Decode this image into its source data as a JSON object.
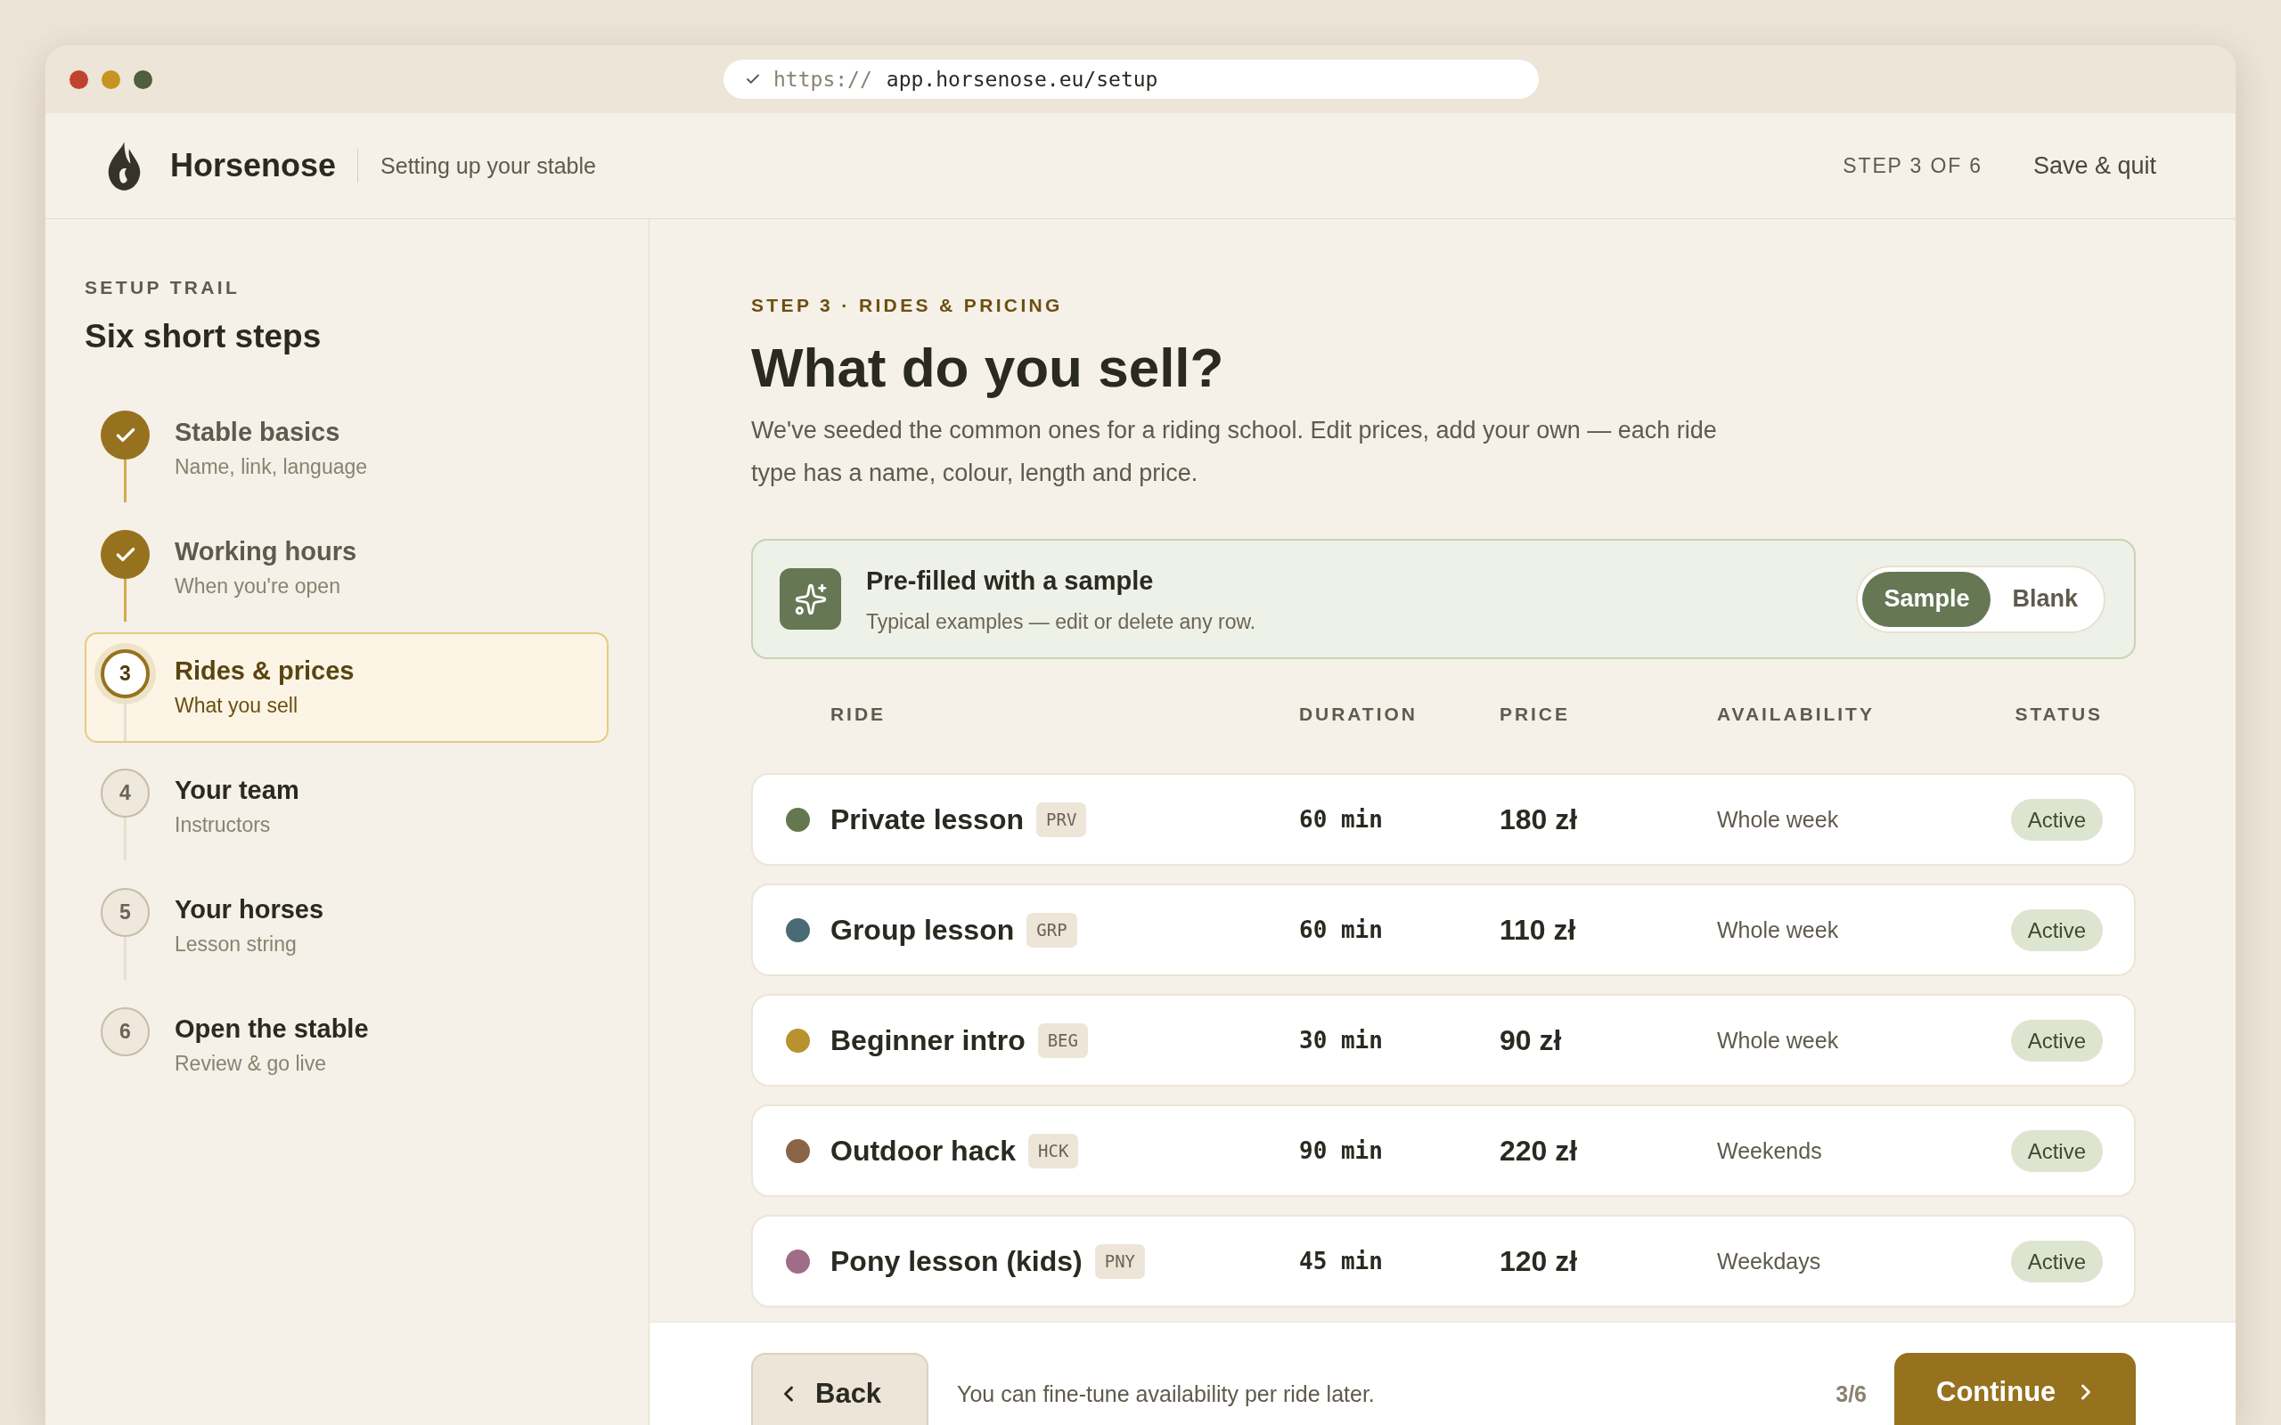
{
  "browser": {
    "url_scheme": "https://",
    "url_path": "app.horsenose.eu/setup"
  },
  "header": {
    "brand": "Horsenose",
    "subtitle": "Setting up your stable",
    "step_counter": "STEP 3 OF 6",
    "save_link": "Save & quit"
  },
  "sidebar": {
    "eyebrow": "SETUP TRAIL",
    "title": "Six short steps",
    "steps": [
      {
        "title": "Stable basics",
        "subtitle": "Name, link, language",
        "done": true,
        "selected": false
      },
      {
        "title": "Working hours",
        "subtitle": "When you're open",
        "done": true,
        "selected": false
      },
      {
        "number": "3",
        "title": "Rides & prices",
        "subtitle": "What you sell",
        "done": false,
        "selected": true
      },
      {
        "number": "4",
        "title": "Your team",
        "subtitle": "Instructors",
        "done": false,
        "selected": false
      },
      {
        "number": "5",
        "title": "Your horses",
        "subtitle": "Lesson string",
        "done": false,
        "selected": false
      },
      {
        "number": "6",
        "title": "Open the stable",
        "subtitle": "Review & go live",
        "done": false,
        "selected": false
      }
    ]
  },
  "main": {
    "eyebrow": "STEP 3 · RIDES & PRICING",
    "title": "What do you sell?",
    "intro": "We've seeded the common ones for a riding school. Edit prices, add your own — each ride type has a name, colour, length and price.",
    "sample_card": {
      "title": "Pre-filled with a sample",
      "subtitle": "Typical examples — edit or delete any row.",
      "options": [
        {
          "label": "Sample",
          "selected": true
        },
        {
          "label": "Blank",
          "selected": false
        }
      ]
    },
    "table": {
      "columns": [
        "RIDE",
        "DURATION",
        "PRICE",
        "AVAILABILITY",
        "STATUS"
      ],
      "rows": [
        {
          "name": "Private lesson",
          "code": "PRV",
          "color": "#65774f",
          "duration": "60 min",
          "price": "180 zł",
          "availability": "Whole week",
          "status": "Active"
        },
        {
          "name": "Group lesson",
          "code": "GRP",
          "color": "#4a6a75",
          "duration": "60 min",
          "price": "110 zł",
          "availability": "Whole week",
          "status": "Active"
        },
        {
          "name": "Beginner intro",
          "code": "BEG",
          "color": "#b8922e",
          "duration": "30 min",
          "price": "90 zł",
          "availability": "Whole week",
          "status": "Active"
        },
        {
          "name": "Outdoor hack",
          "code": "HCK",
          "color": "#8a6446",
          "duration": "90 min",
          "price": "220 zł",
          "availability": "Weekends",
          "status": "Active"
        },
        {
          "name": "Pony lesson (kids)",
          "code": "PNY",
          "color": "#a06c88",
          "duration": "45 min",
          "price": "120 zł",
          "availability": "Weekdays",
          "status": "Active"
        }
      ]
    }
  },
  "footer": {
    "back": "Back",
    "hint": "You can fine-tune availability per ride later.",
    "progress": "3/6",
    "continue": "Continue"
  }
}
